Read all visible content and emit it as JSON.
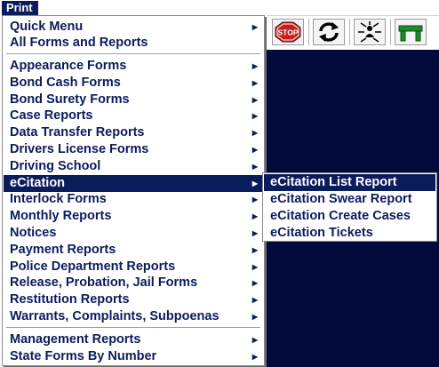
{
  "menubar": {
    "print_label": "Print"
  },
  "main_menu": {
    "items": [
      {
        "label": "Quick Menu",
        "has_submenu": true
      },
      {
        "label": "All Forms and Reports",
        "has_submenu": false
      },
      {
        "label": "Appearance Forms",
        "has_submenu": true
      },
      {
        "label": "Bond Cash Forms",
        "has_submenu": true
      },
      {
        "label": "Bond Surety Forms",
        "has_submenu": true
      },
      {
        "label": "Case Reports",
        "has_submenu": true
      },
      {
        "label": "Data Transfer Reports",
        "has_submenu": true
      },
      {
        "label": "Drivers License Forms",
        "has_submenu": true
      },
      {
        "label": "Driving School",
        "has_submenu": true
      },
      {
        "label": "eCitation",
        "has_submenu": true
      },
      {
        "label": "Interlock Forms",
        "has_submenu": true
      },
      {
        "label": "Monthly Reports",
        "has_submenu": true
      },
      {
        "label": "Notices",
        "has_submenu": true
      },
      {
        "label": "Payment Reports",
        "has_submenu": true
      },
      {
        "label": "Police Department Reports",
        "has_submenu": true
      },
      {
        "label": "Release, Probation, Jail Forms",
        "has_submenu": true
      },
      {
        "label": "Restitution Reports",
        "has_submenu": true
      },
      {
        "label": "Warrants, Complaints, Subpoenas",
        "has_submenu": true
      },
      {
        "label": "Management Reports",
        "has_submenu": true
      },
      {
        "label": "State Forms By Number",
        "has_submenu": true
      }
    ],
    "active_item": "eCitation",
    "submenu_arrow": "▶"
  },
  "submenu": {
    "items": [
      {
        "label": "eCitation List Report"
      },
      {
        "label": "eCitation Swear Report"
      },
      {
        "label": "eCitation Create Cases"
      },
      {
        "label": "eCitation Tickets"
      }
    ],
    "active_item": "eCitation List Report"
  },
  "toolbar": {
    "buttons": [
      {
        "icon": "stop-sign-icon",
        "text": "STOP"
      },
      {
        "icon": "refresh-icon"
      },
      {
        "icon": "network-people-icon"
      },
      {
        "icon": "green-table-icon"
      }
    ]
  },
  "colors": {
    "menu_text": "#0b1c5c",
    "highlight": "#0b1c5c",
    "app_background": "#020a3c",
    "stop_red": "#c41e1e",
    "table_green": "#1f8a2a"
  }
}
